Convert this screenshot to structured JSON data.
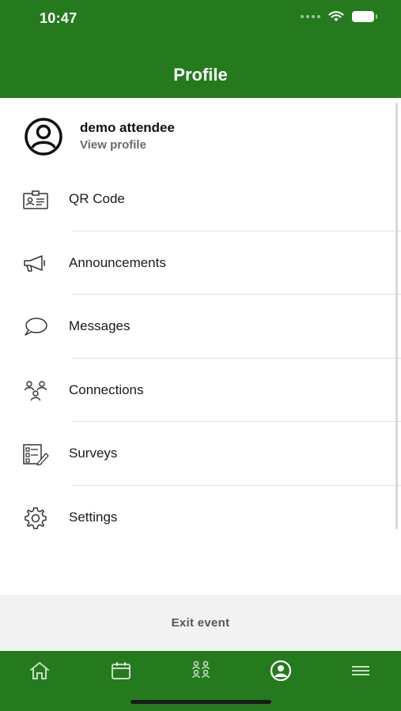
{
  "status_bar": {
    "time": "10:47"
  },
  "header": {
    "title": "Profile"
  },
  "profile": {
    "name": "demo attendee",
    "link": "View profile"
  },
  "menu": [
    {
      "label": "QR Code",
      "icon": "qr-code-badge-icon"
    },
    {
      "label": "Announcements",
      "icon": "megaphone-icon"
    },
    {
      "label": "Messages",
      "icon": "speech-bubble-icon"
    },
    {
      "label": "Connections",
      "icon": "people-network-icon"
    },
    {
      "label": "Surveys",
      "icon": "survey-checklist-icon"
    },
    {
      "label": "Settings",
      "icon": "gear-icon"
    }
  ],
  "exit": {
    "label": "Exit event"
  },
  "tabbar": [
    {
      "name": "home-icon",
      "active": false
    },
    {
      "name": "calendar-icon",
      "active": false
    },
    {
      "name": "attendees-icon",
      "active": false
    },
    {
      "name": "profile-icon",
      "active": true
    },
    {
      "name": "hamburger-menu-icon",
      "active": false
    }
  ],
  "colors": {
    "brand_green": "#257A1E",
    "exit_bar_bg": "#f2f2f2"
  }
}
